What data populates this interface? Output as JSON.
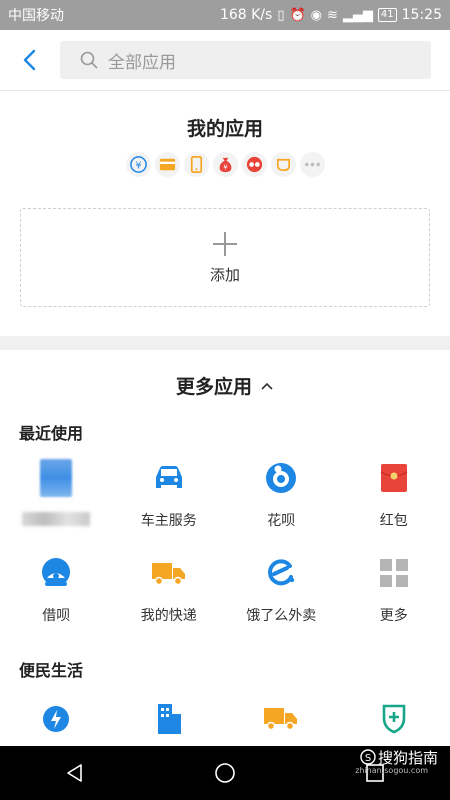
{
  "status": {
    "carrier": "中国移动",
    "speed": "168 K/s",
    "battery": "41",
    "time": "15:25"
  },
  "search": {
    "placeholder": "全部应用"
  },
  "my_apps": {
    "title": "我的应用",
    "icons": [
      "yuan-circle-icon",
      "card-icon",
      "phone-icon",
      "money-bag-icon",
      "glasses-icon",
      "cup-icon",
      "more-dots-icon"
    ],
    "add_label": "添加"
  },
  "more_apps": {
    "title": "更多应用",
    "recent_label": "最近使用",
    "recent": [
      {
        "label": "",
        "icon": "blurred-app-icon"
      },
      {
        "label": "车主服务",
        "icon": "car-icon"
      },
      {
        "label": "花呗",
        "icon": "huabei-icon"
      },
      {
        "label": "红包",
        "icon": "red-packet-icon"
      },
      {
        "label": "借呗",
        "icon": "jiebei-icon"
      },
      {
        "label": "我的快递",
        "icon": "truck-icon"
      },
      {
        "label": "饿了么外卖",
        "icon": "eleme-icon"
      },
      {
        "label": "更多",
        "icon": "grid-icon"
      }
    ],
    "convenience_label": "便民生活",
    "convenience": [
      {
        "icon": "water-drop-icon"
      },
      {
        "icon": "building-icon"
      },
      {
        "icon": "truck-icon"
      },
      {
        "icon": "medical-shield-icon"
      }
    ]
  },
  "watermark": {
    "text": "搜狗指南",
    "url": "zhinan.sogou.com"
  },
  "colors": {
    "accent": "#1e87e4",
    "orange": "#f5a623",
    "red": "#e8443a",
    "status_bar": "#9e9e9e"
  }
}
